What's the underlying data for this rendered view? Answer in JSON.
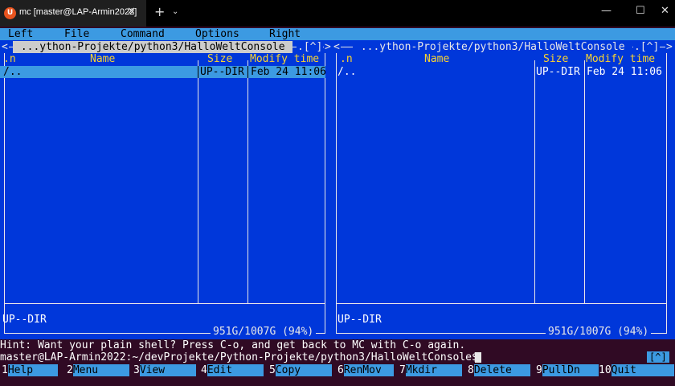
{
  "window": {
    "tab_title": "mc [master@LAP-Armin2022]",
    "tab_icon_letter": "U",
    "close_tab_glyph": "✕",
    "new_tab_glyph": "+",
    "dropdown_glyph": "⌄",
    "minimize_glyph": "—",
    "maximize_glyph": "☐",
    "close_glyph": "✕"
  },
  "menu": [
    {
      "label": "Left"
    },
    {
      "label": "File"
    },
    {
      "label": "Command"
    },
    {
      "label": "Options"
    },
    {
      "label": "Right"
    }
  ],
  "panels": {
    "left": {
      "path": " ...ython-Projekte/python3/HalloWeltConsole ",
      "left_arrow": "<",
      "right_arrow": ">",
      "corner": ".[^]",
      "columns": {
        "sort": ".n",
        "name": "Name",
        "size": "Size",
        "mtime": "Modify time"
      },
      "rows": [
        {
          "name": "/..",
          "size": "UP--DIR",
          "mtime": "Feb 24 11:06"
        }
      ],
      "status": "UP--DIR",
      "free": "951G/1007G (94%)"
    },
    "right": {
      "path": " ...ython-Projekte/python3/HalloWeltConsole ",
      "left_arrow": "<",
      "right_arrow": ">",
      "corner": ".[^]",
      "columns": {
        "sort": ".n",
        "name": "Name",
        "size": "Size",
        "mtime": "Modify time"
      },
      "rows": [
        {
          "name": "/..",
          "size": "UP--DIR",
          "mtime": "Feb 24 11:06"
        }
      ],
      "status": "UP--DIR",
      "free": "951G/1007G (94%)"
    }
  },
  "hint": "Hint: Want your plain shell? Press C-o, and get back to MC with C-o again.",
  "prompt": "master@LAP-Armin2022:~/devProjekte/Python-Projekte/python3/HalloWeltConsole$",
  "term_indicator": "[^]",
  "function_keys": [
    {
      "num": "1",
      "label": "Help"
    },
    {
      "num": "2",
      "label": "Menu"
    },
    {
      "num": "3",
      "label": "View"
    },
    {
      "num": "4",
      "label": "Edit"
    },
    {
      "num": "5",
      "label": "Copy"
    },
    {
      "num": "6",
      "label": "RenMov"
    },
    {
      "num": "7",
      "label": "Mkdir"
    },
    {
      "num": "8",
      "label": "Delete"
    },
    {
      "num": "9",
      "label": "PullDn"
    },
    {
      "num": "10",
      "label": "Quit"
    }
  ],
  "colors": {
    "panel_bg": "#0037da",
    "accent": "#3c9ae2",
    "header_text": "#f9d430",
    "terminal_bg": "#300a24"
  }
}
